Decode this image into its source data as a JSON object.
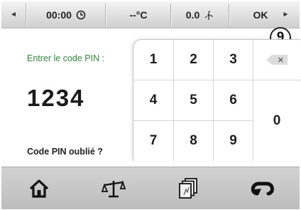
{
  "status_bar": {
    "left_arrow": "◄",
    "time": "00:00",
    "temperature": "--°C",
    "wind": "0.0",
    "ok_label": "OK",
    "right_arrow": "►"
  },
  "step_badge": "9",
  "pin_entry": {
    "prompt": "Entrer le code PIN :",
    "value": "1234",
    "forgot_link": "Code PIN oublié ?"
  },
  "keypad": {
    "keys": [
      "1",
      "2",
      "3",
      "4",
      "5",
      "6",
      "7",
      "8",
      "9"
    ],
    "zero": "0",
    "delete_glyph": "✕"
  },
  "bottom_nav": {
    "icons": [
      "home-icon",
      "balance-icon",
      "pages-icon",
      "return-icon"
    ]
  },
  "colors": {
    "prompt_green": "#2e8b3b",
    "bar_grey": "#c8c8c8"
  }
}
